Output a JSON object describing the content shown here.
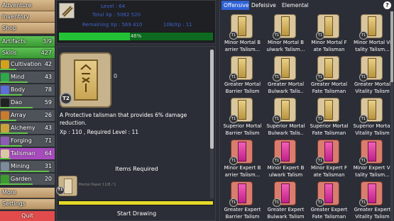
{
  "sidebar": {
    "top": [
      "Adventure",
      "Inventory",
      "Shop"
    ],
    "artifacts": {
      "label": "Artifacts",
      "value": "3/9"
    },
    "skills": {
      "label": "Skills",
      "value": "427"
    },
    "skill_items": [
      {
        "label": "Cultivation",
        "value": "42",
        "color": "#d2a21c",
        "bar": 0.3
      },
      {
        "label": "Mind",
        "value": "43",
        "color": "#2fa84a",
        "bar": 0.5
      },
      {
        "label": "Body",
        "value": "78",
        "color": "#5b6fd6",
        "bar": 0.4
      },
      {
        "label": "Dao",
        "value": "59",
        "color": "#222222",
        "bar": 0.6
      },
      {
        "label": "Array",
        "value": "26",
        "color": "#c87b2e",
        "bar": 0.3
      },
      {
        "label": "Alchemy",
        "value": "43",
        "color": "#c9a33b",
        "bar": 0.5
      },
      {
        "label": "Forging",
        "value": "71",
        "color": "#8d5bb5",
        "bar": 0.4
      },
      {
        "label": "Talisman",
        "value": "64",
        "color": "#d9c9a1",
        "bar": 0.2
      },
      {
        "label": "Mining",
        "value": "31",
        "color": "#7d8a9a",
        "bar": 0.9
      },
      {
        "label": "Garden",
        "value": "20",
        "color": "#3c9a2f",
        "bar": 0.6
      }
    ],
    "bottom": [
      "More",
      "Settings"
    ],
    "quit": "Quit"
  },
  "header": {
    "level": "Level : 64",
    "total_xp": "Total Xp : 5082 520",
    "remaining_xp": "Remaining Xp : 569 410",
    "xp_rate": "108/Xp : 11",
    "progress_percent": 46,
    "progress_label": "46%"
  },
  "detail": {
    "tier": "T2",
    "count": "0",
    "description": "A Protective talisman that provides 6% damage reduction.",
    "requirements": "Xp : 110 , Required Level : 11",
    "items_required_title": "Items Required",
    "mini_item_label": "Mortal Paper   11/8 / 1",
    "mini_item_tier": "T1",
    "start_button": "Start Drawing"
  },
  "right": {
    "tabs": [
      "Offensive",
      "Defeisive",
      "Elemental"
    ],
    "help": "?",
    "items": [
      {
        "name": [
          "Minor Mortal B",
          "arrier Talism..."
        ],
        "style": "gold"
      },
      {
        "name": [
          "Minor Mortal B",
          "ulwark Talism..."
        ],
        "style": "gold"
      },
      {
        "name": [
          "Minor Mortal F",
          "ate Talisman"
        ],
        "style": "gold"
      },
      {
        "name": [
          "Minor Mortal Vi",
          "tality Talism..."
        ],
        "style": "gold"
      },
      {
        "name": [
          "Greater Mortal",
          "Barrier Talism"
        ],
        "style": "gold"
      },
      {
        "name": [
          "Greater Mortal",
          "Bulwark Talis.."
        ],
        "style": "gold"
      },
      {
        "name": [
          "Greater Mortal",
          "Fate Talisman"
        ],
        "style": "gold"
      },
      {
        "name": [
          "Greater Mortal",
          "Vitality Talism"
        ],
        "style": "gold"
      },
      {
        "name": [
          "Superior Mortal",
          "Barrier Talism"
        ],
        "style": "gold"
      },
      {
        "name": [
          "Superior Mortal",
          "Bulwark Talis.."
        ],
        "style": "gold"
      },
      {
        "name": [
          "Superior Mortal",
          "Fate Talisman"
        ],
        "style": "gold"
      },
      {
        "name": [
          "Superior Mortal",
          "Vitality Talism"
        ],
        "style": "gold"
      },
      {
        "name": [
          "Minor Expert B",
          "arrier Talism..."
        ],
        "style": "pink"
      },
      {
        "name": [
          "Minor Expert B",
          "ulwark Talism"
        ],
        "style": "pink"
      },
      {
        "name": [
          "Minor Expert F",
          "ate Talisman"
        ],
        "style": "pink"
      },
      {
        "name": [
          "Minor Expert Vi",
          "tality Talism..."
        ],
        "style": "pink"
      },
      {
        "name": [
          "Greater Expert",
          "Barrier Talism"
        ],
        "style": "pink"
      },
      {
        "name": [
          "Greater Expert",
          "Bulwark Talism"
        ],
        "style": "pink"
      },
      {
        "name": [
          "Greater Expert",
          "Fate Talisman"
        ],
        "style": "pink"
      },
      {
        "name": [
          "Greater Expert",
          "Vitality Talism"
        ],
        "style": "pink"
      }
    ],
    "item_tier": "T1"
  }
}
